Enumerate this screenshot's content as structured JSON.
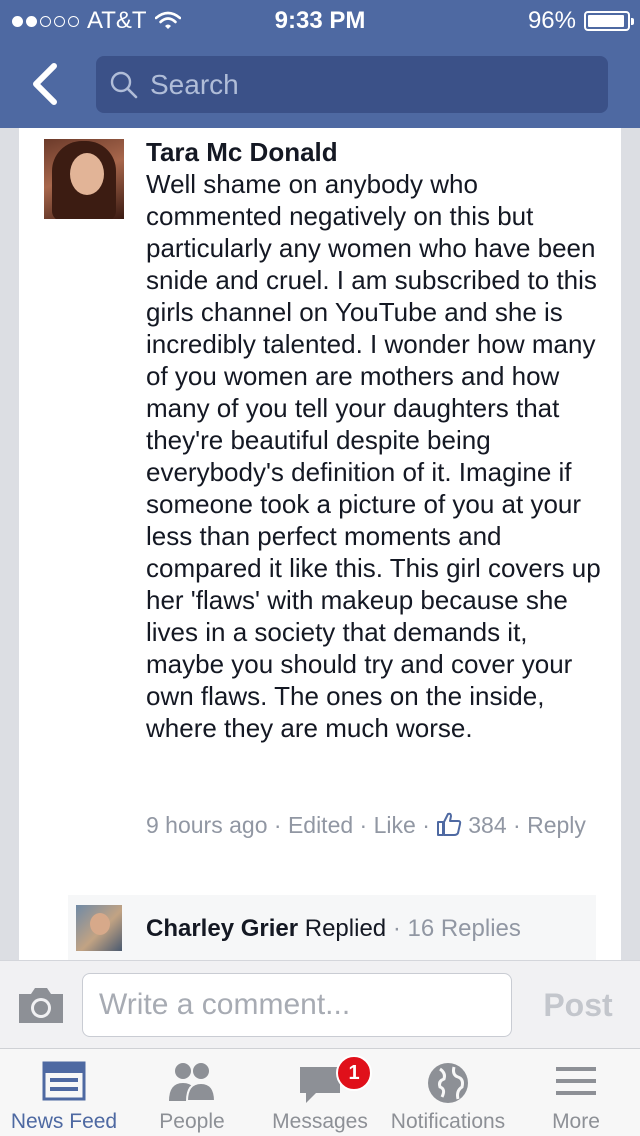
{
  "status_bar": {
    "carrier": "AT&T",
    "time": "9:33 PM",
    "battery": "96%",
    "battery_level": 0.96
  },
  "nav": {
    "search_placeholder": "Search"
  },
  "comment": {
    "author": "Tara Mc Donald",
    "text": "Well shame on anybody who commented negatively on this but particularly any women who have been snide and cruel. I am subscribed to this girls channel on YouTube and she is incredibly talented. I wonder how many of you women are mothers and how many of you tell your daughters that they're beautiful despite being everybody's definition of it. Imagine if someone took a picture of you at your less than perfect moments and compared it like this. This girl covers up her 'flaws' with makeup because she lives in a society that demands it, maybe you should try and cover your own flaws. The ones on the inside, where they are much worse.",
    "time": "9 hours ago",
    "edited": "Edited",
    "like": "Like",
    "likes": "384",
    "reply": "Reply",
    "sep": "·"
  },
  "reply_preview": {
    "name": "Charley Grier",
    "action": "Replied",
    "count": "16 Replies",
    "sep": "·"
  },
  "composer": {
    "placeholder": "Write a comment...",
    "post": "Post"
  },
  "tabs": [
    {
      "label": "News Feed",
      "icon": "news-feed-icon",
      "active": true
    },
    {
      "label": "People",
      "icon": "people-icon"
    },
    {
      "label": "Messages",
      "icon": "messages-icon"
    },
    {
      "label": "Notifications",
      "icon": "globe-icon"
    },
    {
      "label": "More",
      "icon": "menu-icon"
    }
  ],
  "messages_badge": "1",
  "colors": {
    "brand": "#4e69a2",
    "search_bg": "#3b5188",
    "badge": "#e0101a",
    "meta": "#9197a3"
  }
}
